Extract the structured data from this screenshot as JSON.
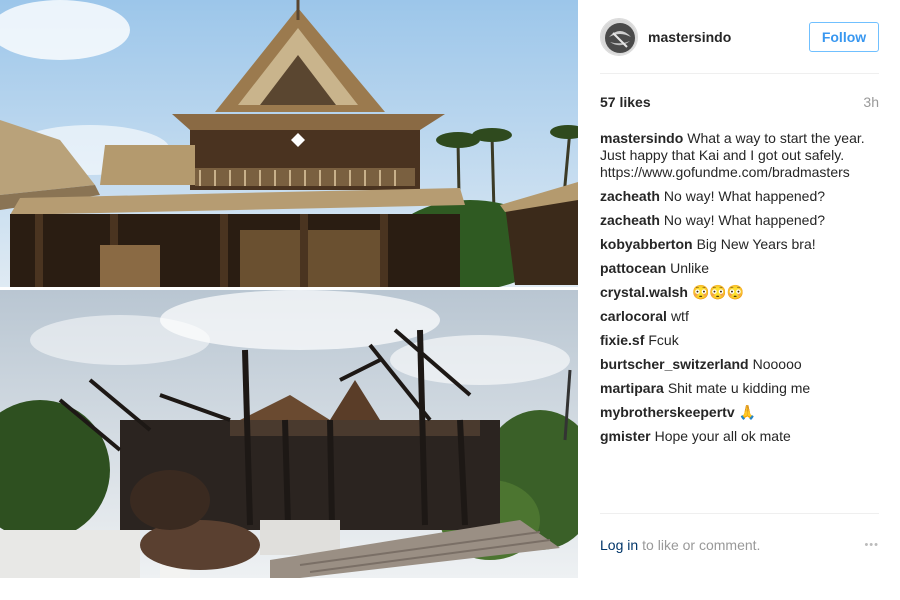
{
  "post": {
    "username": "mastersindo",
    "follow_label": "Follow",
    "likes": "57 likes",
    "time_ago": "3h",
    "caption_lines": [
      "What a way to start the year.",
      "Just happy that Kai and I got out safely.",
      "https://www.gofundme.com/bradmasters"
    ]
  },
  "comments": [
    {
      "user": "zacheath",
      "text": "No way! What happened?"
    },
    {
      "user": "zacheath",
      "text": "No way! What happened?"
    },
    {
      "user": "kobyabberton",
      "text": "Big New Years bra!"
    },
    {
      "user": "pattocean",
      "text": "Unlike"
    },
    {
      "user": "crystal.walsh",
      "text": "😳😳😳"
    },
    {
      "user": "carlocoral",
      "text": "wtf"
    },
    {
      "user": "fixie.sf",
      "text": "Fcuk"
    },
    {
      "user": "burtscher_switzerland",
      "text": "Nooooo"
    },
    {
      "user": "martipara",
      "text": "Shit mate u kidding me"
    },
    {
      "user": "mybrotherskeepertv",
      "text": "🙏"
    },
    {
      "user": "gmister",
      "text": "Hope your all ok mate"
    }
  ],
  "footer": {
    "login_link": "Log in",
    "login_rest": "to like or comment.",
    "more_icon": "•••"
  },
  "colors": {
    "link_blue": "#3897f0",
    "follow_border": "#70c0ff",
    "muted": "#999999"
  }
}
